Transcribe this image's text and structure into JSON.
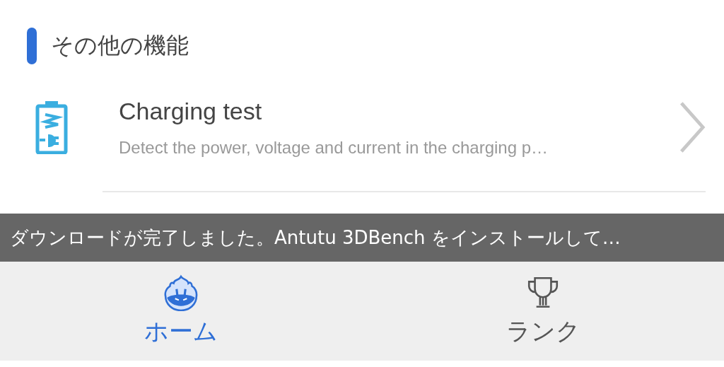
{
  "section": {
    "title": "その他の機能"
  },
  "items": [
    {
      "title": "Charging test",
      "description": "Detect the power, voltage and current in the charging p…"
    }
  ],
  "toast": {
    "text": "ダウンロードが完了しました。Antutu 3DBench をインストールして…"
  },
  "tabs": [
    {
      "label": "ホーム",
      "selected": true,
      "kind": "home"
    },
    {
      "label": "ランク",
      "selected": false,
      "kind": "rank"
    }
  ]
}
